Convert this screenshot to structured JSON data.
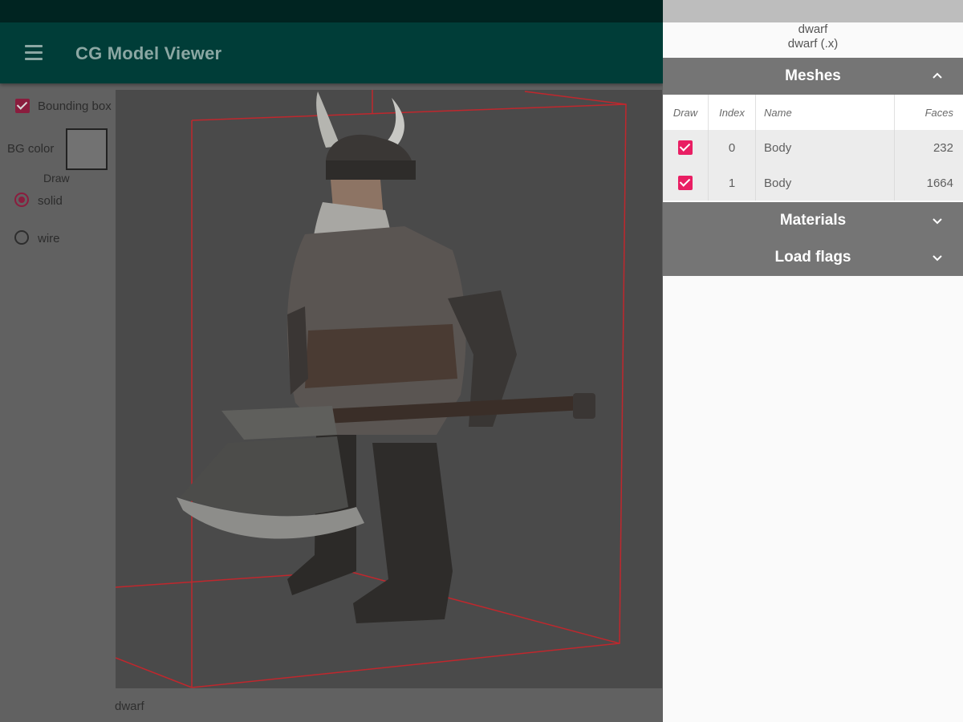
{
  "app": {
    "title": "CG Model Viewer",
    "menu_icon": "hamburger-menu-icon"
  },
  "controls": {
    "bounding_box_label": "Bounding box",
    "bounding_box_checked": true,
    "bg_color_label": "BG color",
    "bg_color_value": "#727272",
    "draw_label": "Draw",
    "draw_options": [
      "solid",
      "wire"
    ],
    "draw_selected": "solid"
  },
  "viewport": {
    "model_label": "dwarf",
    "bounding_box_color": "#c0272d"
  },
  "side_panel": {
    "model_name": "dwarf",
    "model_file": "dwarf (.x)",
    "sections": {
      "meshes": {
        "label": "Meshes",
        "expanded": true
      },
      "materials": {
        "label": "Materials",
        "expanded": false
      },
      "load_flags": {
        "label": "Load flags",
        "expanded": false
      }
    },
    "mesh_table": {
      "headers": {
        "draw": "Draw",
        "index": "Index",
        "name": "Name",
        "faces": "Faces"
      },
      "rows": [
        {
          "draw": true,
          "index": "0",
          "name": "Body",
          "faces": "232"
        },
        {
          "draw": true,
          "index": "1",
          "name": "Body",
          "faces": "1664"
        }
      ]
    }
  },
  "colors": {
    "accent": "#e91e63",
    "app_bar": "#003d38",
    "section_header": "#757575"
  }
}
